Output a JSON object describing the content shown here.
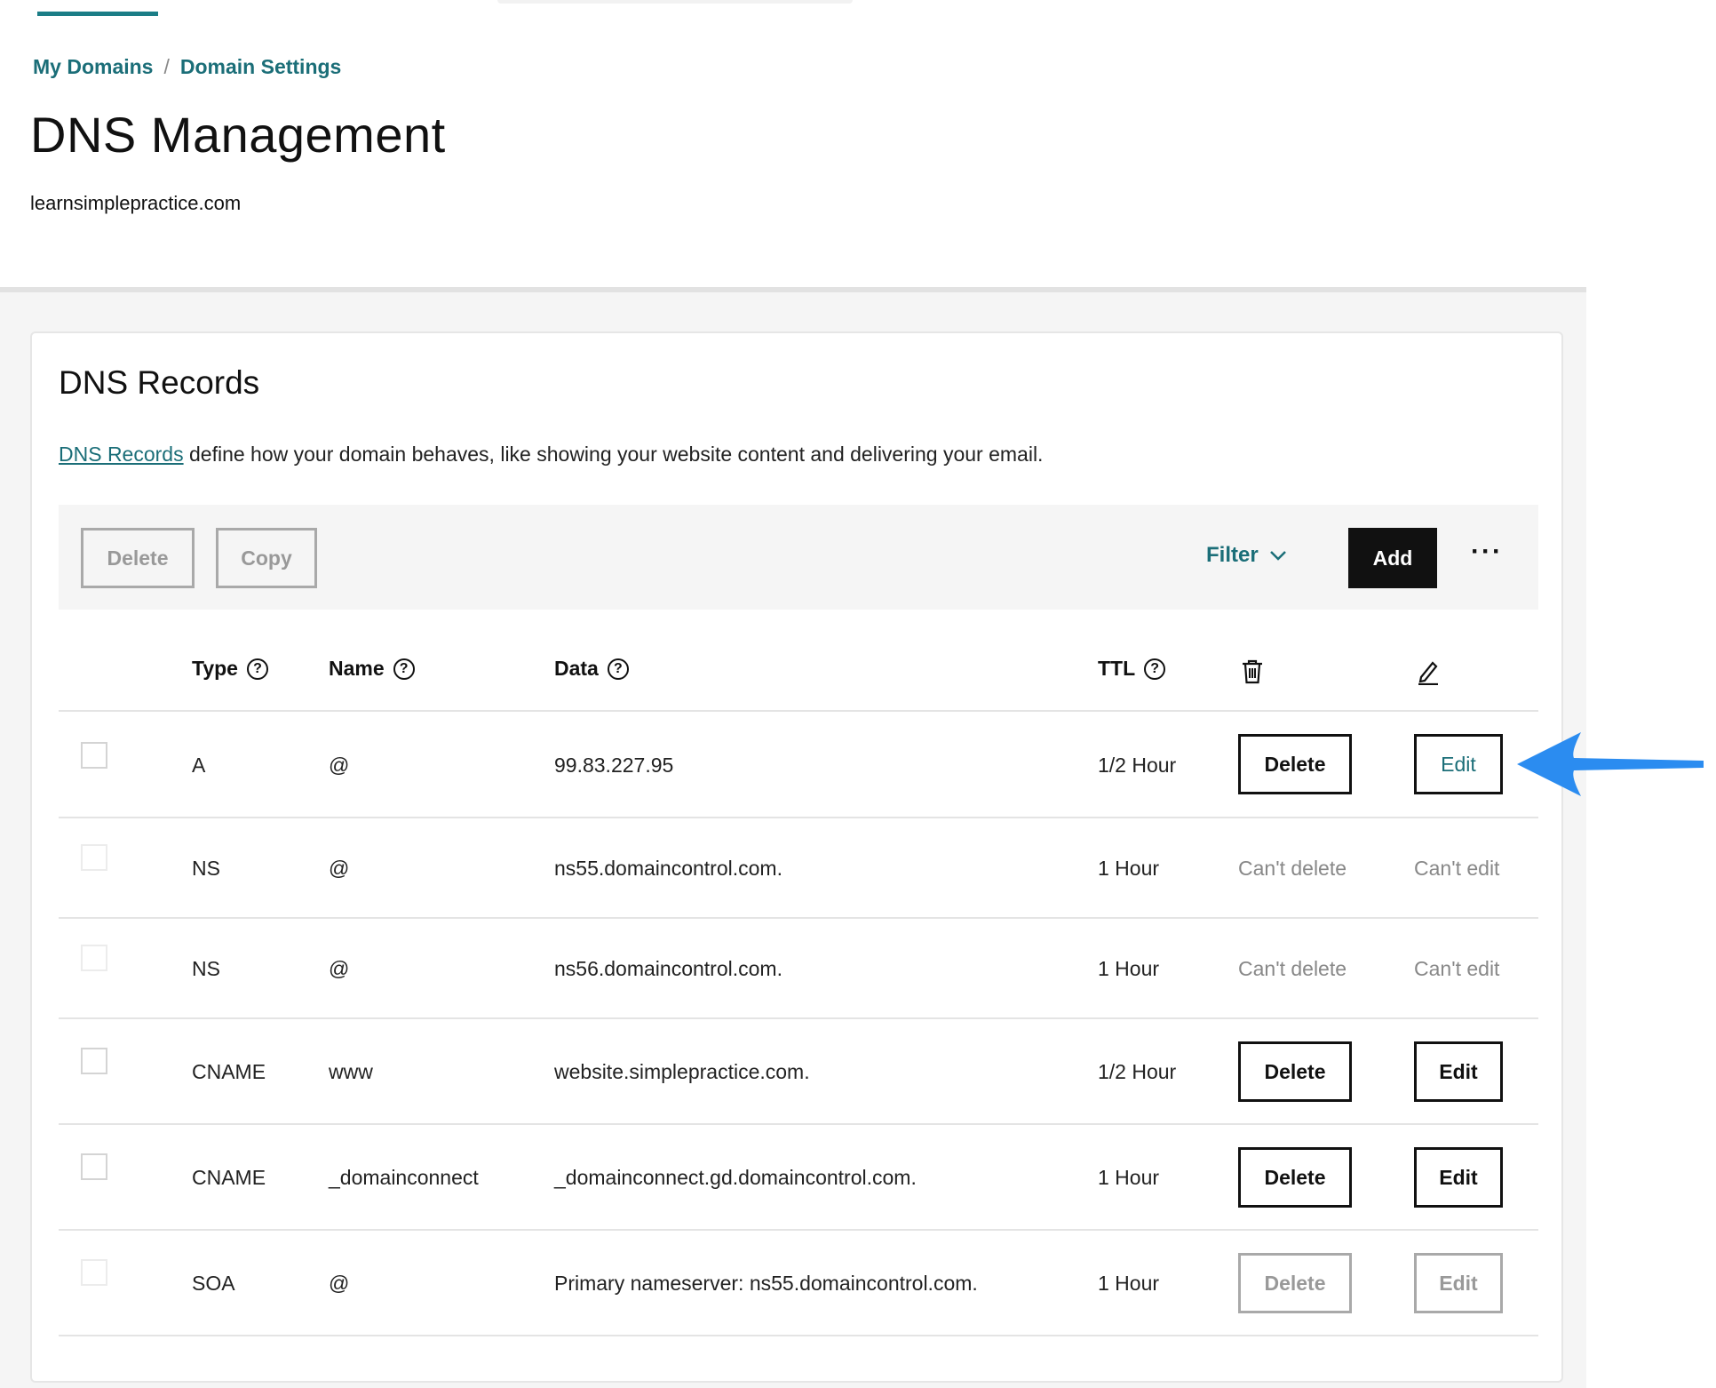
{
  "breadcrumb": {
    "items": [
      "My Domains",
      "Domain Settings"
    ],
    "separator": "/"
  },
  "page": {
    "title": "DNS Management",
    "domain": "learnsimplepractice.com"
  },
  "records_card": {
    "title": "DNS Records",
    "desc_link": "DNS Records",
    "desc_text": "define how your domain behaves, like showing your website content and delivering your email."
  },
  "toolbar": {
    "delete_label": "Delete",
    "copy_label": "Copy",
    "filter_label": "Filter",
    "add_label": "Add",
    "more_label": "···"
  },
  "table": {
    "headers": {
      "type": "Type",
      "name": "Name",
      "data": "Data",
      "ttl": "TTL"
    },
    "help_glyph": "?",
    "rows": [
      {
        "type": "A",
        "name": "@",
        "data": "99.83.227.95",
        "ttl": "1/2 Hour",
        "delete": "Delete",
        "edit": "Edit"
      },
      {
        "type": "NS",
        "name": "@",
        "data": "ns55.domaincontrol.com.",
        "ttl": "1 Hour",
        "delete": "Can't delete",
        "edit": "Can't edit"
      },
      {
        "type": "NS",
        "name": "@",
        "data": "ns56.domaincontrol.com.",
        "ttl": "1 Hour",
        "delete": "Can't delete",
        "edit": "Can't edit"
      },
      {
        "type": "CNAME",
        "name": "www",
        "data": "website.simplepractice.com.",
        "ttl": "1/2 Hour",
        "delete": "Delete",
        "edit": "Edit"
      },
      {
        "type": "CNAME",
        "name": "_domainconnect",
        "data": "_domainconnect.gd.domaincontrol.com.",
        "ttl": "1 Hour",
        "delete": "Delete",
        "edit": "Edit"
      },
      {
        "type": "SOA",
        "name": "@",
        "data": "Primary nameserver: ns55.domaincontrol.com.",
        "ttl": "1 Hour",
        "delete": "Delete",
        "edit": "Edit"
      }
    ]
  },
  "colors": {
    "accent": "#1b6e78",
    "annotation_arrow": "#2b8cf0"
  }
}
